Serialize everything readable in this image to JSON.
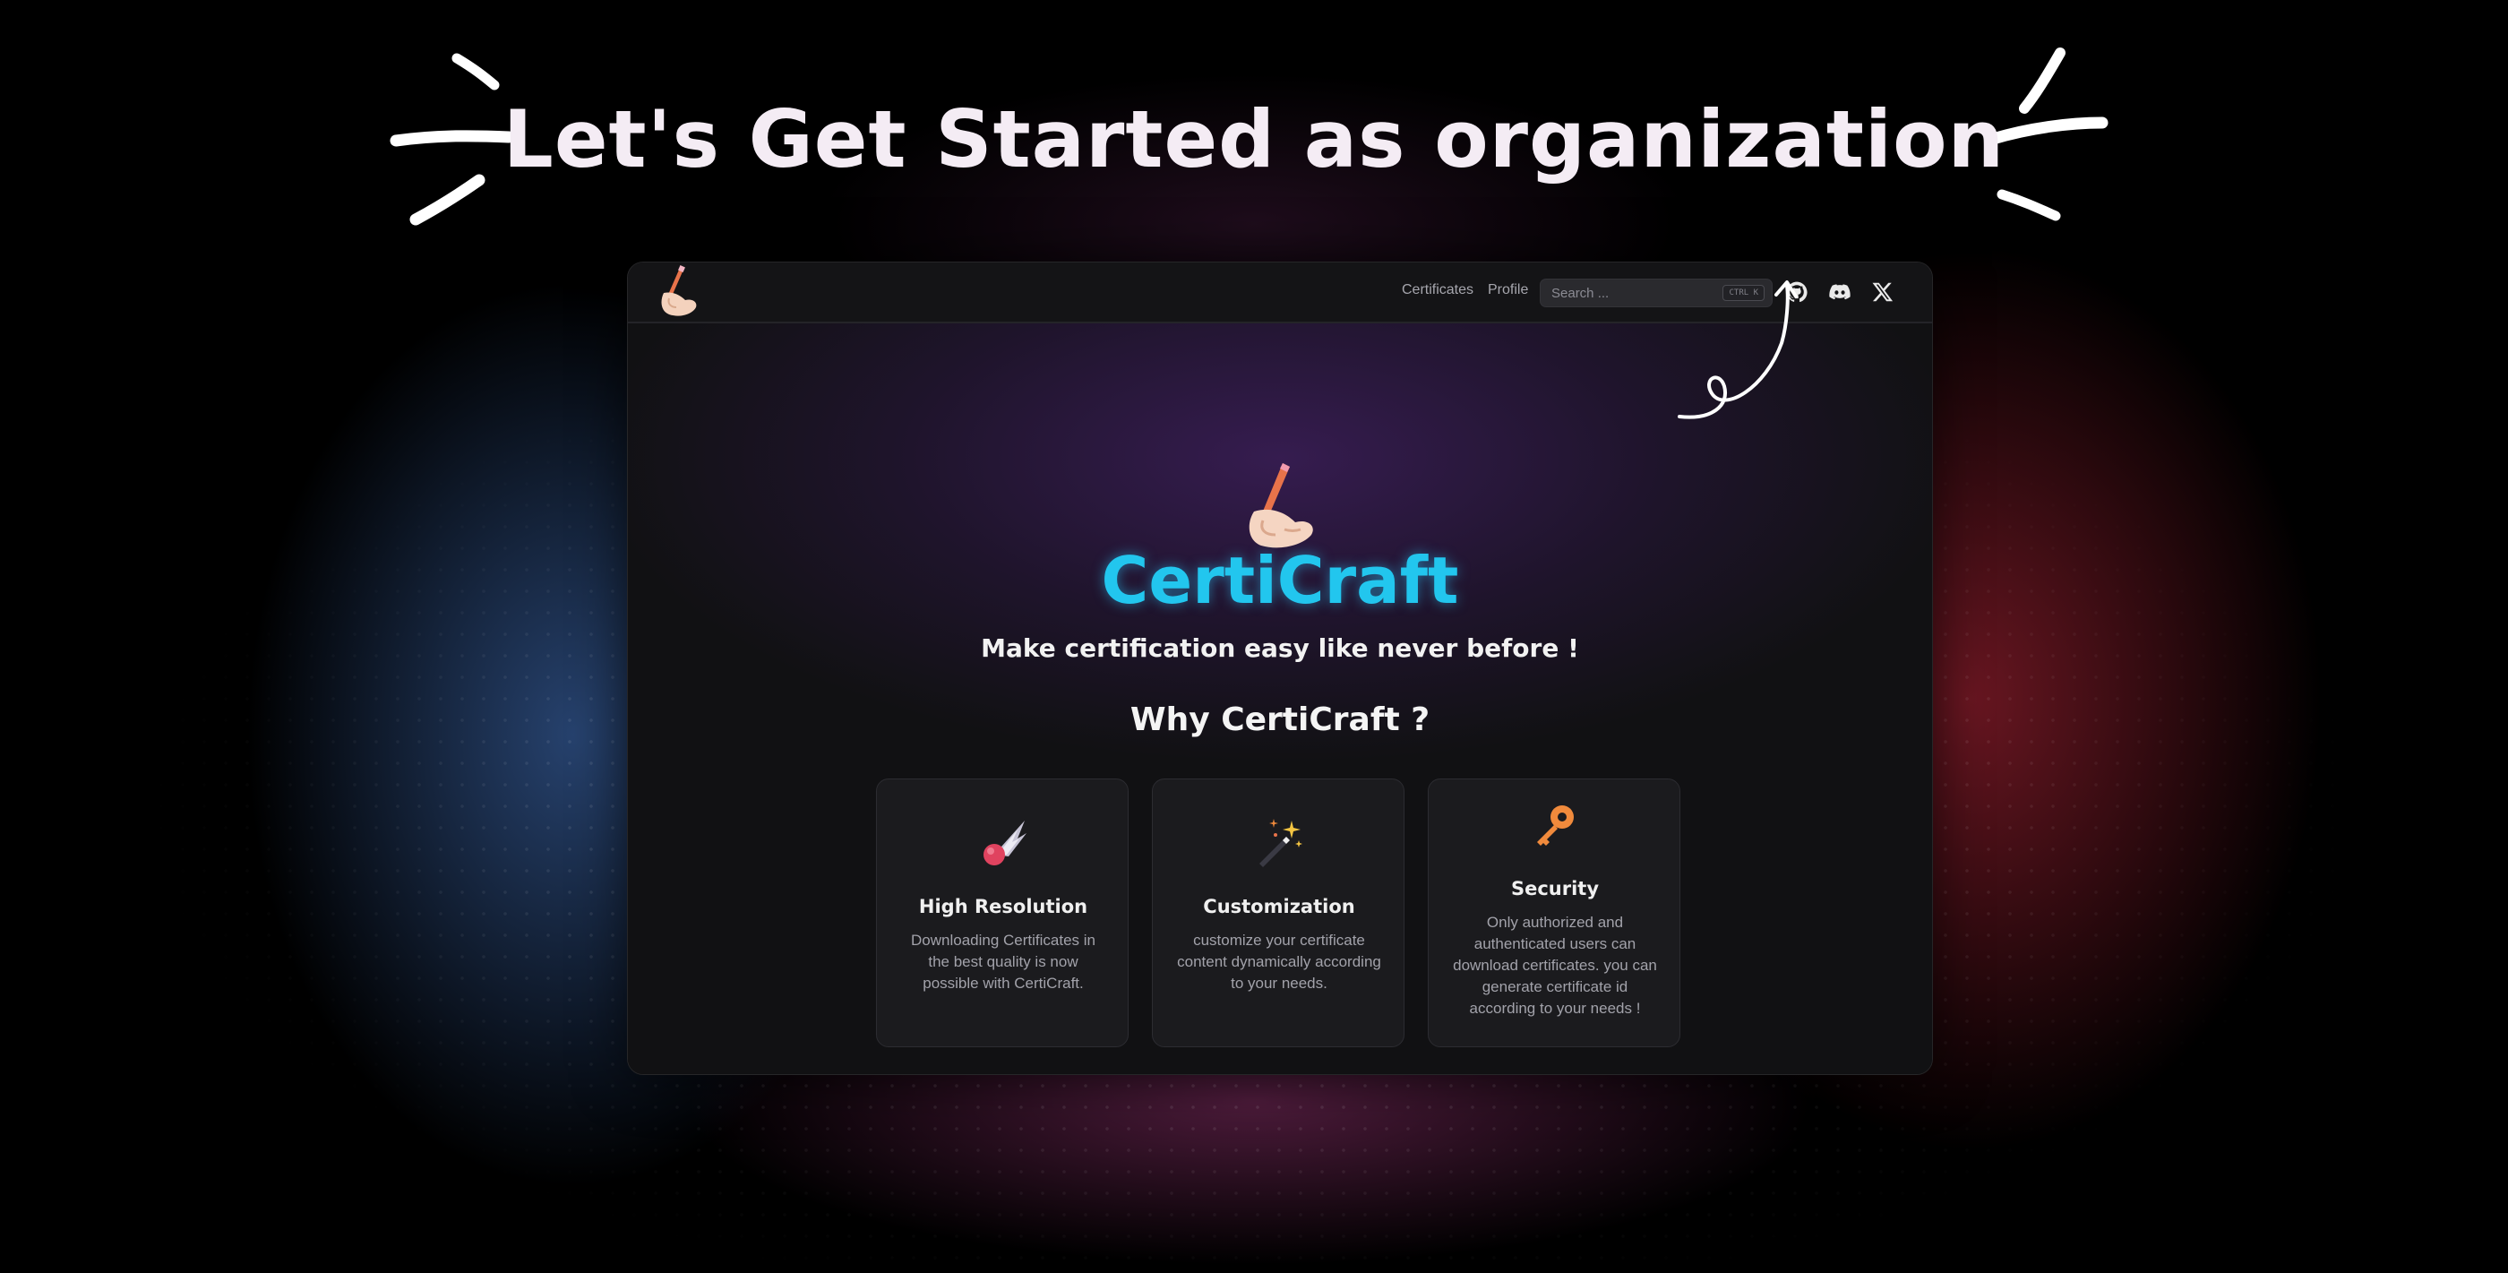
{
  "headline": "Let's Get Started as organization",
  "nav": {
    "links": [
      "Certificates",
      "Profile"
    ],
    "search_placeholder": "Search ...",
    "search_shortcut": "CTRL K",
    "icons": [
      "github-icon",
      "discord-icon",
      "x-icon"
    ]
  },
  "hero": {
    "brand": "CertiCraft",
    "tagline": "Make certification easy like never before !",
    "why_heading": "Why CertiCraft ?"
  },
  "features": [
    {
      "icon": "comet-icon",
      "title": "High Resolution",
      "description": "Downloading Certificates in the best quality is now possible with CertiCraft."
    },
    {
      "icon": "magic-wand-icon",
      "title": "Customization",
      "description": "customize your certificate content dynamically according to your needs."
    },
    {
      "icon": "key-icon",
      "title": "Security",
      "description": "Only authorized and authenticated users can download certificates. you can generate certificate id according to your needs !"
    }
  ],
  "colors": {
    "brand": "#22c6ee",
    "background": "#000000",
    "window": "#111113",
    "card": "#1b1b1e",
    "glow_left": "#4678c8",
    "glow_right": "#be283c"
  }
}
